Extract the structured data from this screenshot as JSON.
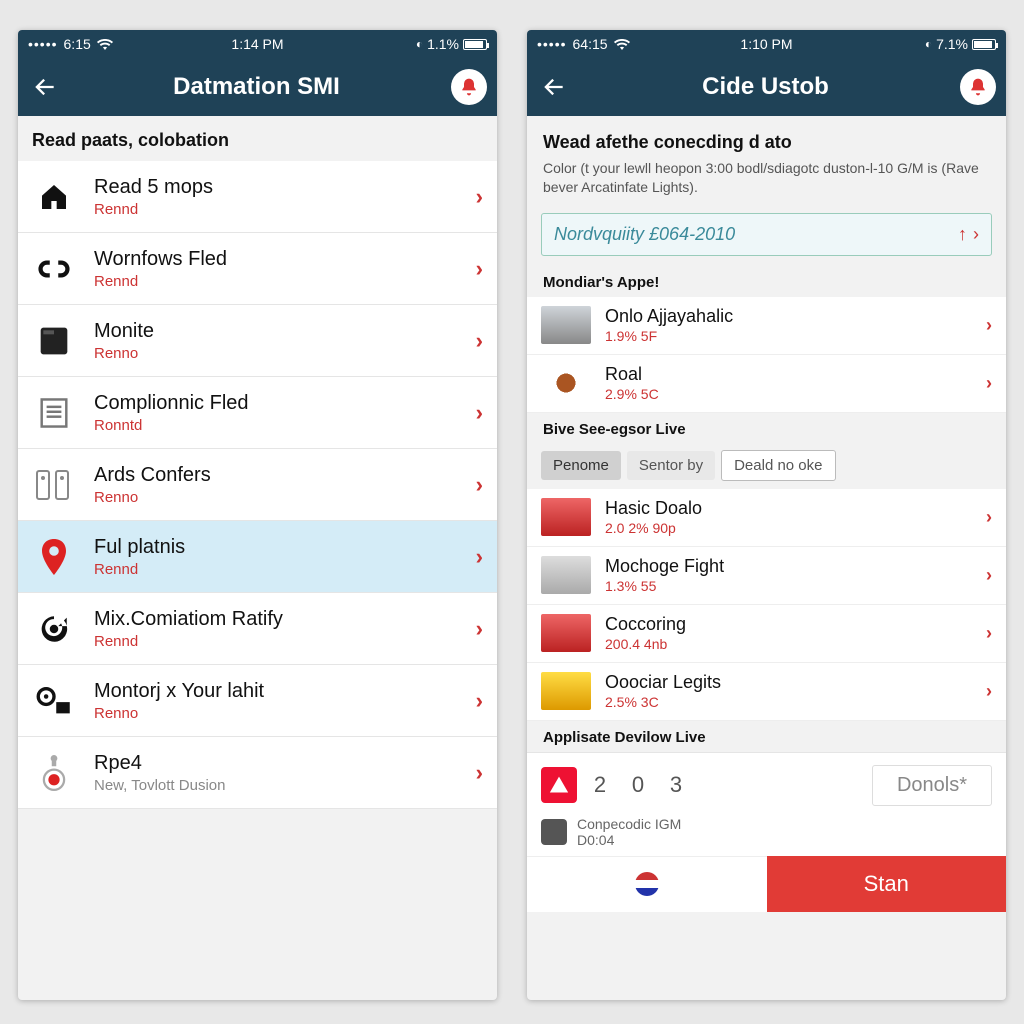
{
  "left": {
    "status": {
      "carrier": "6:15",
      "time": "1:14 PM",
      "battery": "1.1%"
    },
    "header": {
      "title": "Datmation SMI"
    },
    "section_label": "Read paats, colobation",
    "items": [
      {
        "title": "Read 5 mops",
        "sub": "Rennd",
        "icon": "home"
      },
      {
        "title": "Wornfows Fled",
        "sub": "Rennd",
        "icon": "link"
      },
      {
        "title": "Monite",
        "sub": "Renno",
        "icon": "panel"
      },
      {
        "title": "Complionnic Fled",
        "sub": "Ronntd",
        "icon": "doc"
      },
      {
        "title": "Ards Confers",
        "sub": "Renno",
        "icon": "servers"
      },
      {
        "title": "Ful platnis",
        "sub": "Rennd",
        "icon": "pin",
        "selected": true
      },
      {
        "title": "Mix.Comiatiom Ratify",
        "sub": "Rennd",
        "icon": "recycle"
      },
      {
        "title": "Montorj x Your lahit",
        "sub": "Renno",
        "icon": "gears"
      },
      {
        "title": "Rpe4",
        "sub": "New, Tovlott Dusion",
        "icon": "record",
        "sub_gray": true
      }
    ]
  },
  "right": {
    "status": {
      "carrier": "64:15",
      "time": "1:10 PM",
      "battery": "7.1%"
    },
    "header": {
      "title": "Cide Ustob"
    },
    "subhead": "Wead afethe conecding d ato",
    "desc": "Color (t your lewll heopon 3:00 bodl/sdiagotc duston-l-10 G/M is (Rave bever Arcatinfate Lights).",
    "search_value": "Nordvquiity £064-2010",
    "group1_label": "Mondiar's Appe!",
    "group1": [
      {
        "title": "Onlo Ajjayahalic",
        "sub": "1.9% 5F",
        "thumb": "dark"
      },
      {
        "title": "Roal",
        "sub": "2.9% 5C",
        "thumb": "ant"
      }
    ],
    "group2_label": "Bive See-egsor Live",
    "filters": {
      "a": "Penome",
      "b": "Sentor by",
      "c": "Deald no oke"
    },
    "group2": [
      {
        "title": "Hasic Doalo",
        "sub": "2.0 2% 90p",
        "thumb": "redc"
      },
      {
        "title": "Mochoge Fight",
        "sub": "1.3% 55",
        "thumb": "silver"
      },
      {
        "title": "Coccoring",
        "sub": "200.4 4nb",
        "thumb": "redc"
      },
      {
        "title": "Ooociar Legits",
        "sub": "2.5% 3C",
        "thumb": "yellow"
      }
    ],
    "bottom_label": "Applisate Devilow Live",
    "nums": [
      "2",
      "0",
      "3"
    ],
    "donols": "Donols*",
    "mini": {
      "line1": "Conpecodic IGM",
      "line2": "D0:04"
    },
    "stan": "Stan"
  }
}
